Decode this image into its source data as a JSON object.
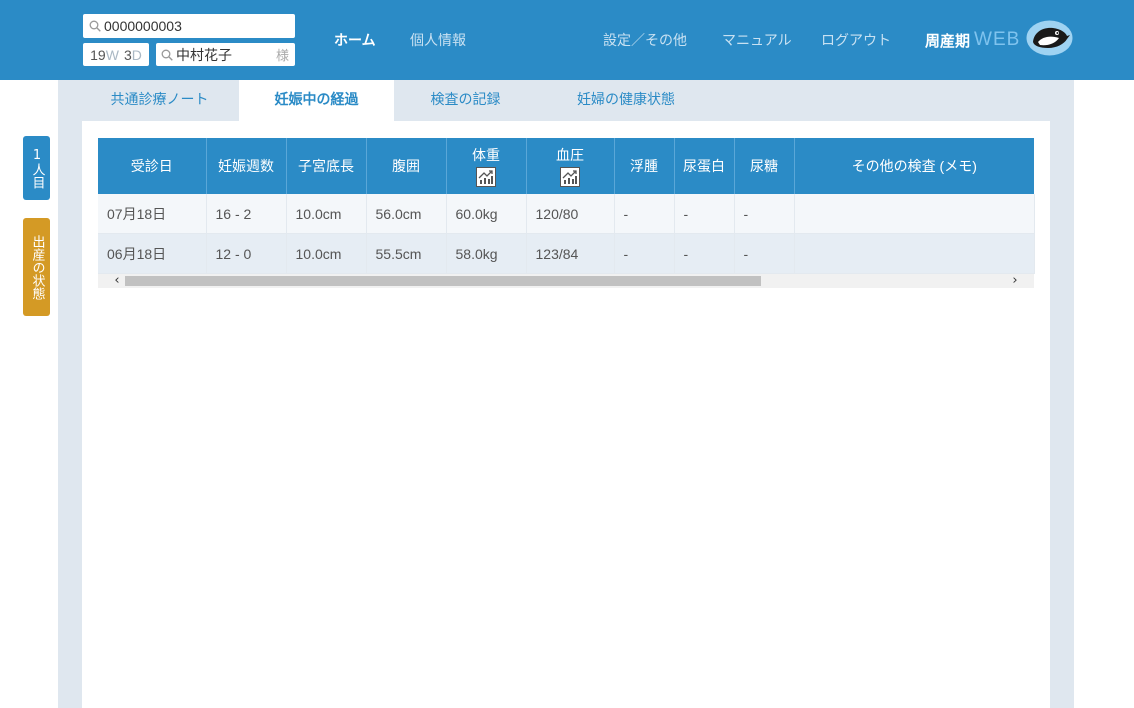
{
  "header": {
    "patient_id": "0000000003",
    "gestation": {
      "weeks": "19",
      "week_unit": "W",
      "days": "3",
      "day_unit": "D"
    },
    "patient_name": "中村花子",
    "honorific": "様",
    "nav": {
      "home": "ホーム",
      "personal_info": "個人情報",
      "settings": "設定／その他",
      "manual": "マニュアル",
      "logout": "ログアウト"
    },
    "brand_jp": "周産期",
    "brand_web": "WEB"
  },
  "side": {
    "person_button": "1人目",
    "birth_button": "出産の状態"
  },
  "tabs": [
    {
      "label": "共通診療ノート",
      "active": false
    },
    {
      "label": "妊娠中の経過",
      "active": true
    },
    {
      "label": "検査の記録",
      "active": false
    },
    {
      "label": "妊婦の健康状態",
      "active": false
    }
  ],
  "table": {
    "columns": [
      "受診日",
      "妊娠週数",
      "子宮底長",
      "腹囲",
      "体重",
      "血圧",
      "浮腫",
      "尿蛋白",
      "尿糖",
      "その他の検査 (メモ)"
    ],
    "chart_columns": [
      "体重",
      "血圧"
    ],
    "rows": [
      [
        "07月18日",
        "16 - 2",
        "10.0cm",
        "56.0cm",
        "60.0kg",
        "120/80",
        "-",
        "-",
        "-",
        ""
      ],
      [
        "06月18日",
        "12 - 0",
        "10.0cm",
        "55.5cm",
        "58.0kg",
        "123/84",
        "-",
        "-",
        "-",
        ""
      ]
    ]
  },
  "colors": {
    "header_blue": "#2b8bc6",
    "birth_button": "#d49a25",
    "panel_bg": "#dfe7ef"
  },
  "icons": {
    "search": "search-icon",
    "chart": "chart-icon",
    "logo": "penguin-logo-icon",
    "scroll_left": "chevron-left-icon",
    "scroll_right": "chevron-right-icon"
  }
}
